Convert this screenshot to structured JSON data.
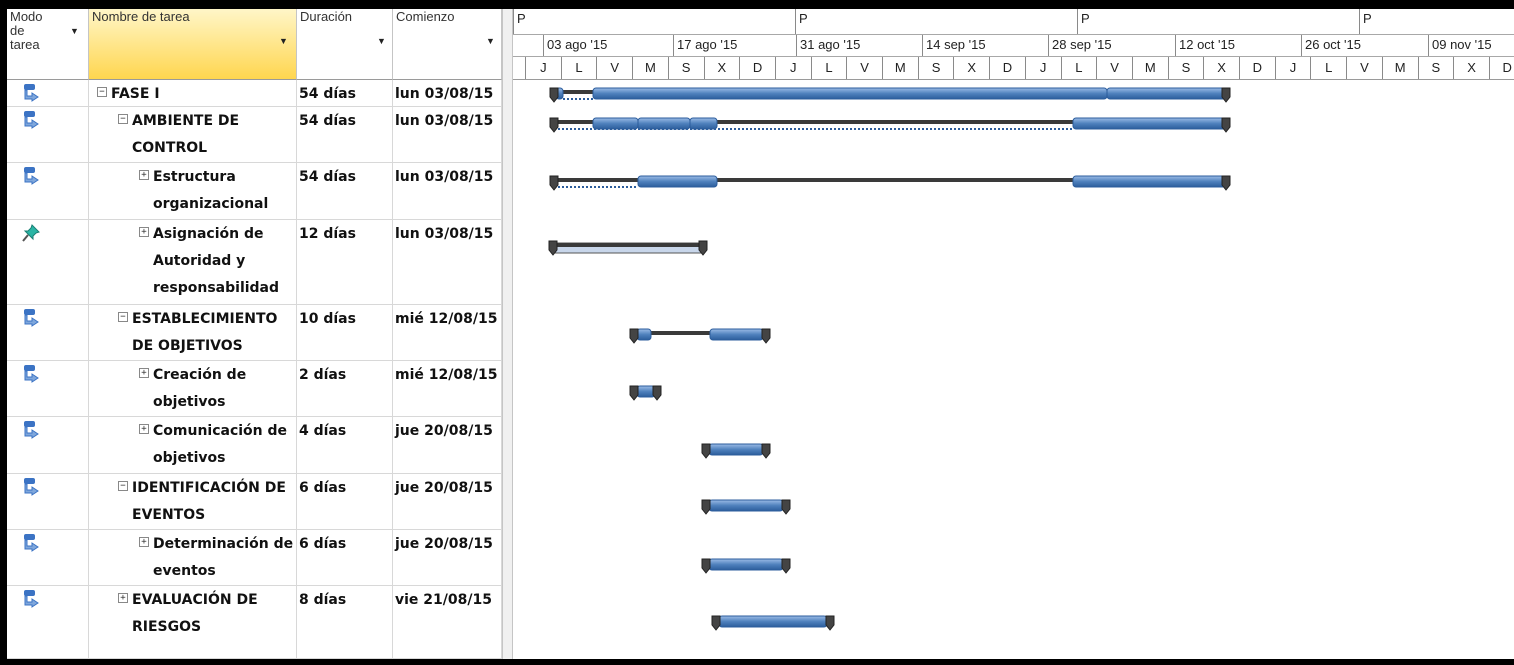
{
  "table": {
    "columns": {
      "modo": "Modo de tarea",
      "nombre": "Nombre de tarea",
      "duracion": "Duración",
      "comienzo": "Comienzo"
    },
    "rows": [
      {
        "name": "FASE I",
        "dur": "54 días",
        "start": "lun 03/08/15",
        "toggle": "−",
        "mode": "auto"
      },
      {
        "name": "AMBIENTE DE CONTROL",
        "dur": "54 días",
        "start": "lun 03/08/15",
        "toggle": "−",
        "mode": "auto"
      },
      {
        "name": "Estructura organizacional",
        "dur": "54 días",
        "start": "lun 03/08/15",
        "toggle": "+",
        "mode": "auto"
      },
      {
        "name": "Asignación de Autoridad y responsabilidad",
        "dur": "12 días",
        "start": "lun 03/08/15",
        "toggle": "+",
        "mode": "manual"
      },
      {
        "name": "ESTABLECIMIENTO DE OBJETIVOS",
        "dur": "10 días",
        "start": "mié 12/08/15",
        "toggle": "−",
        "mode": "auto"
      },
      {
        "name": "Creación de objetivos",
        "dur": "2 días",
        "start": "mié 12/08/15",
        "toggle": "+",
        "mode": "auto"
      },
      {
        "name": "Comunicación de objetivos",
        "dur": "4 días",
        "start": "jue 20/08/15",
        "toggle": "+",
        "mode": "auto"
      },
      {
        "name": "IDENTIFICACIÓN DE EVENTOS",
        "dur": "6 días",
        "start": "jue 20/08/15",
        "toggle": "−",
        "mode": "auto"
      },
      {
        "name": "Determinación de eventos",
        "dur": "6 días",
        "start": "jue 20/08/15",
        "toggle": "+",
        "mode": "auto"
      },
      {
        "name": "EVALUACIÓN DE RIESGOS",
        "dur": "8 días",
        "start": "vie 21/08/15",
        "toggle": "+",
        "mode": "auto"
      }
    ]
  },
  "timeline": {
    "top_labels": [
      "P",
      "P",
      "P",
      "P"
    ],
    "week_labels": [
      "03 ago '15",
      "17 ago '15",
      "31 ago '15",
      "14 sep '15",
      "28 sep '15",
      "12 oct '15",
      "26 oct '15",
      "09 nov '15"
    ],
    "day_letters": [
      "J",
      "L",
      "V",
      "M",
      "S",
      "X",
      "D",
      "J",
      "L",
      "V",
      "M",
      "S",
      "X",
      "D",
      "J",
      "L",
      "V",
      "M",
      "S",
      "X",
      "D",
      "J",
      "L",
      "V",
      "M",
      "S",
      "X",
      "D"
    ]
  },
  "colors": {
    "bar_blue": "#4f81bd",
    "summary_dark": "#3a3a3a",
    "header_highlight": "#ffd64f",
    "auto_icon": "#3b73c4",
    "manual_icon": "#2ab5a5"
  },
  "icons": {
    "auto": "auto-scheduled-icon",
    "manual": "manual-pin-icon"
  }
}
